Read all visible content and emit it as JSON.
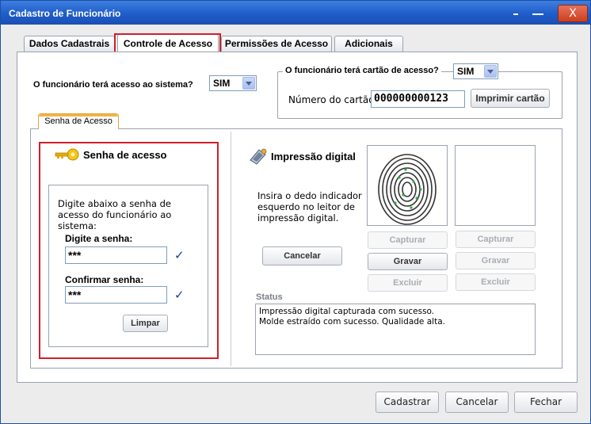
{
  "window": {
    "title": "Cadastro de Funcionário",
    "close_glyph": "X"
  },
  "tabs": [
    {
      "label": "Dados Cadastrais"
    },
    {
      "label": "Controle de Acesso"
    },
    {
      "label": "Permissões de Acesso"
    },
    {
      "label": "Adicionais"
    }
  ],
  "access": {
    "system_label": "O funcionário terá acesso ao sistema?",
    "system_value": "SIM",
    "card_label": "O funcionário terá cartão de acesso?",
    "card_value": "SIM",
    "card_number_label": "Número do cartão",
    "card_number_value": "000000000123",
    "print_card_button": "Imprimir cartão"
  },
  "subtab": {
    "label": "Senha de Acesso"
  },
  "password": {
    "header": "Senha de acesso",
    "instruction": "Digite abaixo a senha de acesso do funcionário ao sistema:",
    "enter_label": "Digite a senha:",
    "enter_value": "***",
    "confirm_label": "Confirmar senha:",
    "confirm_value": "***",
    "clear_button": "Limpar",
    "check_glyph": "✓"
  },
  "fingerprint": {
    "header": "Impressão digital",
    "instruction": "Insira o dedo indicador esquerdo no leitor de impressão digital.",
    "cancel_button": "Cancelar",
    "left": {
      "capture": "Capturar",
      "save": "Gravar",
      "delete": "Excluir"
    },
    "right": {
      "capture": "Capturar",
      "save": "Gravar",
      "delete": "Excluir"
    }
  },
  "status": {
    "label": "Status",
    "lines": [
      "Impressão digital capturada com sucesso.",
      "Molde estraído com sucesso. Qualidade alta."
    ]
  },
  "footer": {
    "register": "Cadastrar",
    "cancel": "Cancelar",
    "close": "Fechar"
  },
  "colors": {
    "title_bar": "#1f5dc9",
    "highlight": "#d0202a",
    "check": "#1b3a9a"
  }
}
